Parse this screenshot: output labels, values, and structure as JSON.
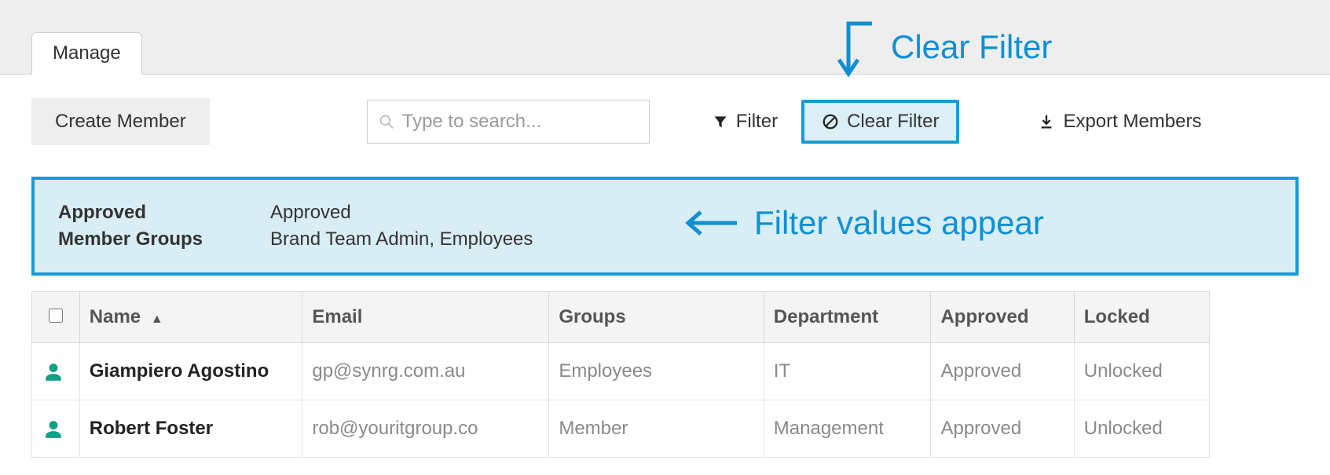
{
  "tab_label": "Manage",
  "toolbar": {
    "create_label": "Create Member",
    "search_placeholder": "Type to search...",
    "filter_label": "Filter",
    "clear_filter_label": "Clear Filter",
    "export_label": "Export Members"
  },
  "callouts": {
    "clear_filter": "Clear Filter",
    "filter_values": "Filter values appear"
  },
  "filter_panel": {
    "rows": [
      {
        "label": "Approved",
        "value": "Approved"
      },
      {
        "label": "Member Groups",
        "value": "Brand Team Admin,  Employees"
      }
    ]
  },
  "table": {
    "headers": {
      "name": "Name",
      "email": "Email",
      "groups": "Groups",
      "department": "Department",
      "approved": "Approved",
      "locked": "Locked"
    },
    "rows": [
      {
        "name": "Giampiero Agostino",
        "email": "gp@synrg.com.au",
        "groups": "Employees",
        "department": "IT",
        "approved": "Approved",
        "locked": "Unlocked"
      },
      {
        "name": "Robert Foster",
        "email": "rob@youritgroup.co",
        "groups": "Member",
        "department": "Management",
        "approved": "Approved",
        "locked": "Unlocked"
      }
    ]
  }
}
